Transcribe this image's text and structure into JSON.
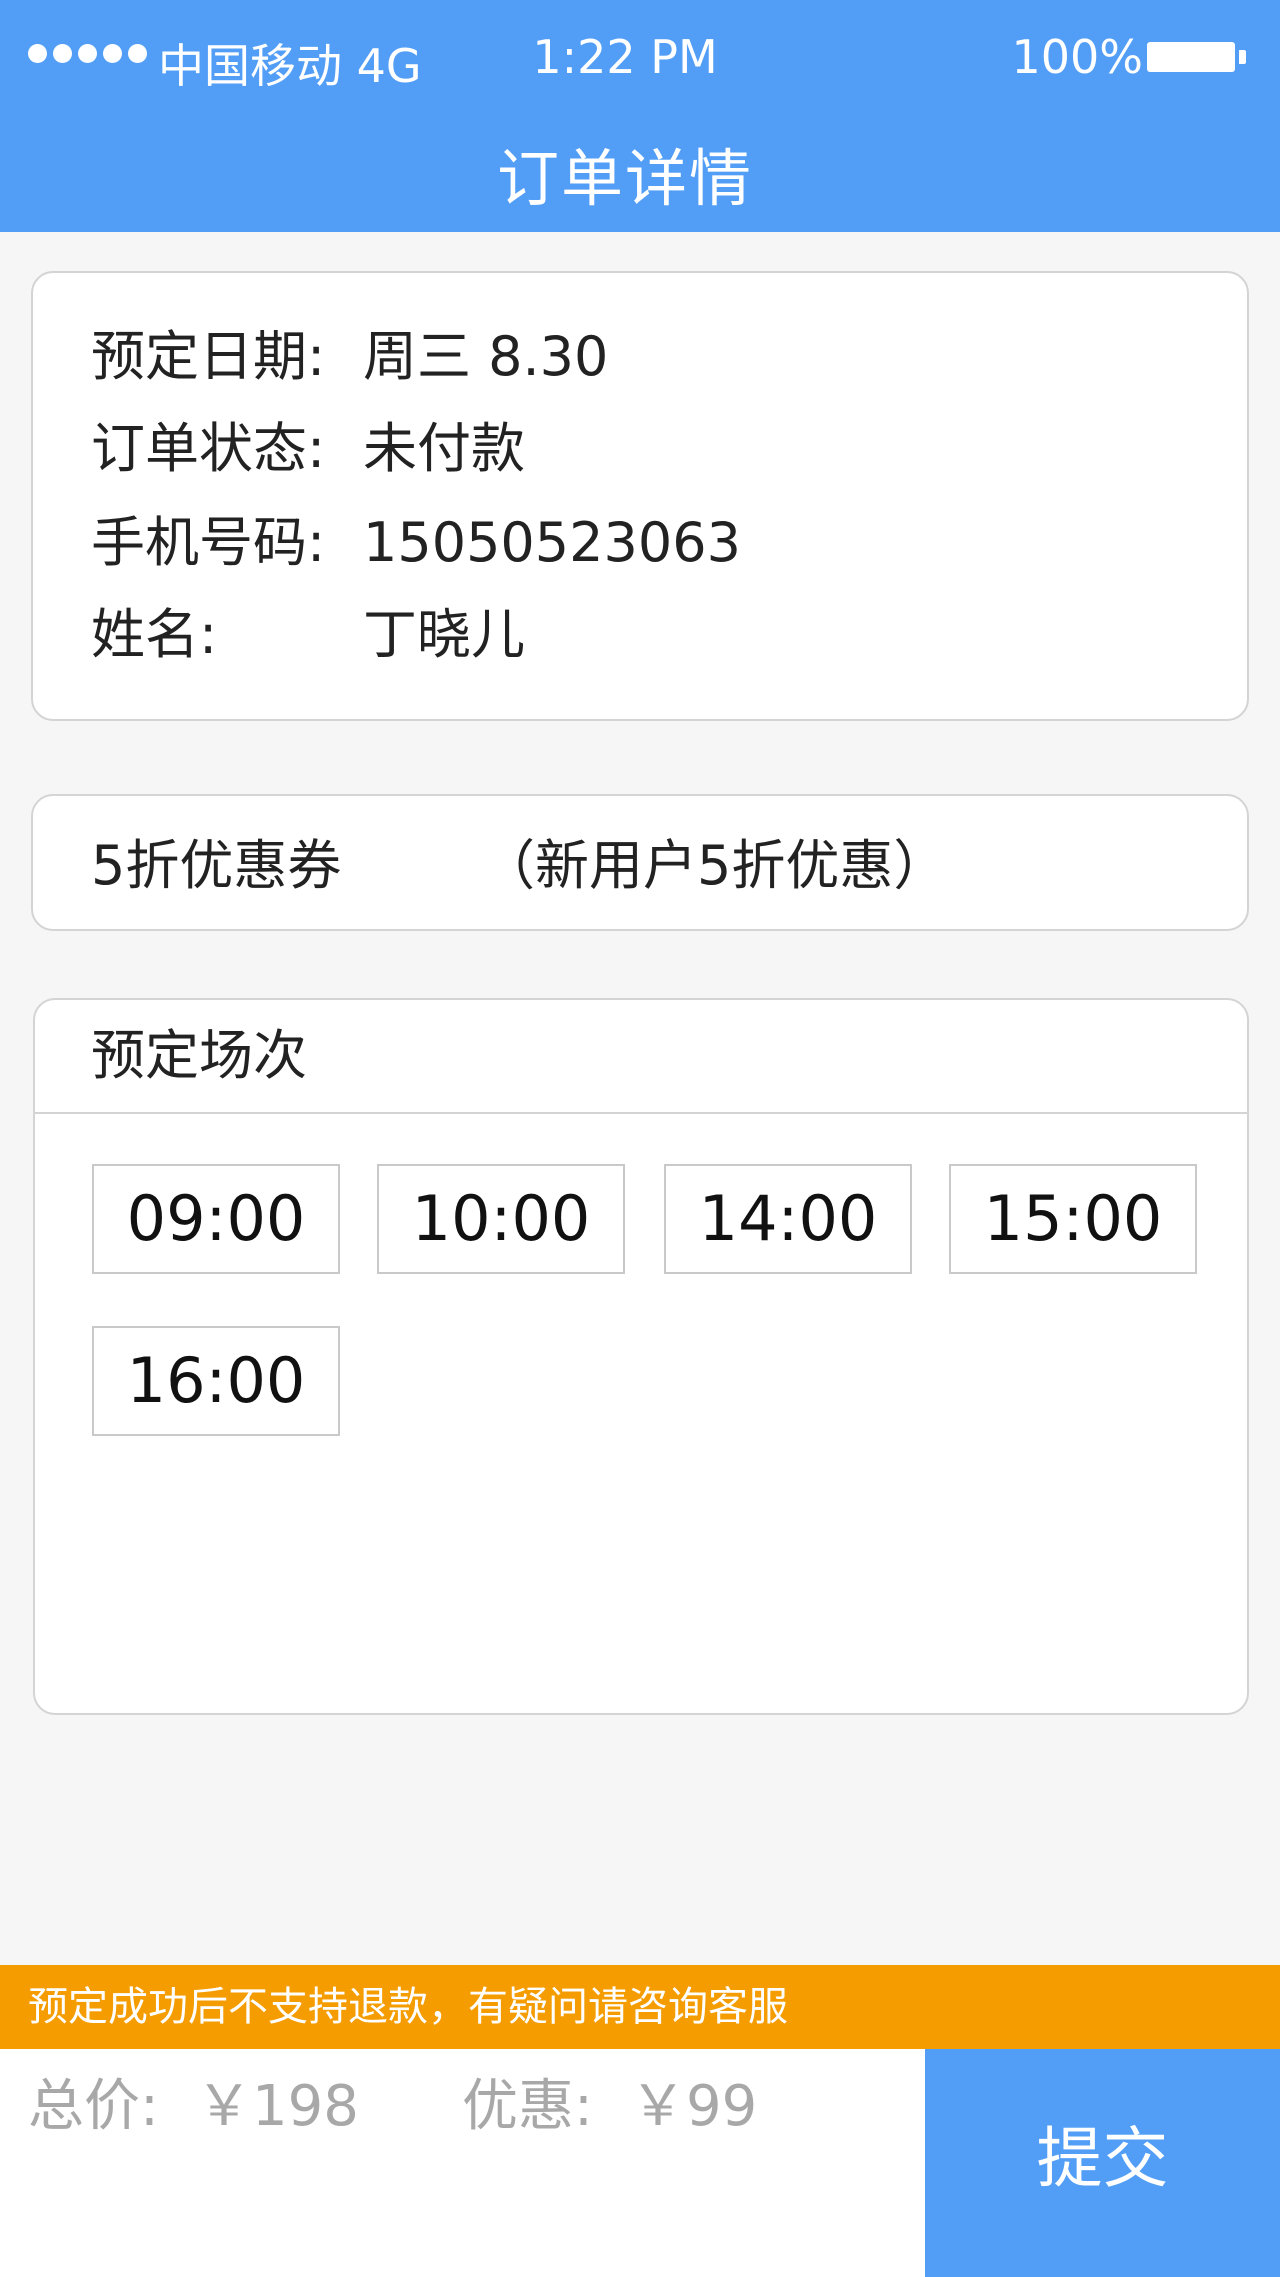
{
  "status_bar": {
    "carrier": "中国移动 4G",
    "time": "1:22 PM",
    "battery": "100%"
  },
  "nav": {
    "title": "订单详情"
  },
  "order_info": [
    {
      "label": "预定日期:",
      "value": "周三 8.30"
    },
    {
      "label": "订单状态:",
      "value": "未付款"
    },
    {
      "label": "手机号码:",
      "value": "15050523063"
    },
    {
      "label": "姓名:",
      "value": "丁晓儿"
    }
  ],
  "coupon": {
    "name": "5折优惠券",
    "description": "（新用户5折优惠）"
  },
  "sessions": {
    "title": "预定场次",
    "slots": [
      "09:00",
      "10:00",
      "14:00",
      "15:00",
      "16:00"
    ]
  },
  "notice": "预定成功后不支持退款，有疑问请咨询客服",
  "footer": {
    "total_label": "总价:",
    "total_value": "￥198",
    "discount_label": "优惠:",
    "discount_value": "￥99",
    "submit_label": "提交"
  },
  "colors": {
    "primary": "#529ef7",
    "notice": "#f59c00",
    "background": "#f6f6f6"
  }
}
